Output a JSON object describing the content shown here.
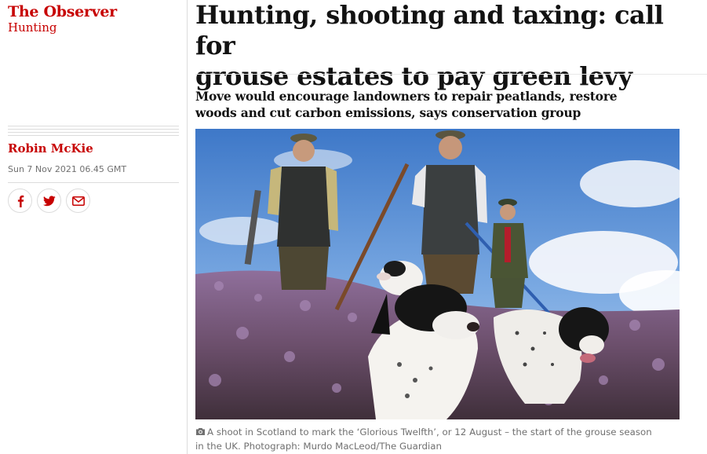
{
  "section": {
    "publication": "The Observer",
    "topic": "Hunting"
  },
  "byline": {
    "author": "Robin McKie",
    "date": "Sun 7 Nov 2021 06.45 GMT"
  },
  "share": {
    "facebook_icon": "facebook-icon",
    "twitter_icon": "twitter-icon",
    "email_icon": "email-icon"
  },
  "article": {
    "headline_line1": "Hunting, shooting and taxing: call for",
    "headline_line2": "grouse estates to pay green levy",
    "standfirst_line1": "Move would encourage landowners to repair peatlands, restore",
    "standfirst_line2": "woods and cut carbon emissions, says conservation group"
  },
  "image": {
    "caption_line1": "A shoot in Scotland to mark the ‘Glorious Twelfth’, or 12 August – the start of the grouse season",
    "caption_line2": "in the UK. Photograph: Murdo MacLeod/The Guardian"
  },
  "colors": {
    "accent": "#c70000",
    "text": "#121212",
    "muted": "#707070",
    "rule": "#dcdcdc"
  }
}
